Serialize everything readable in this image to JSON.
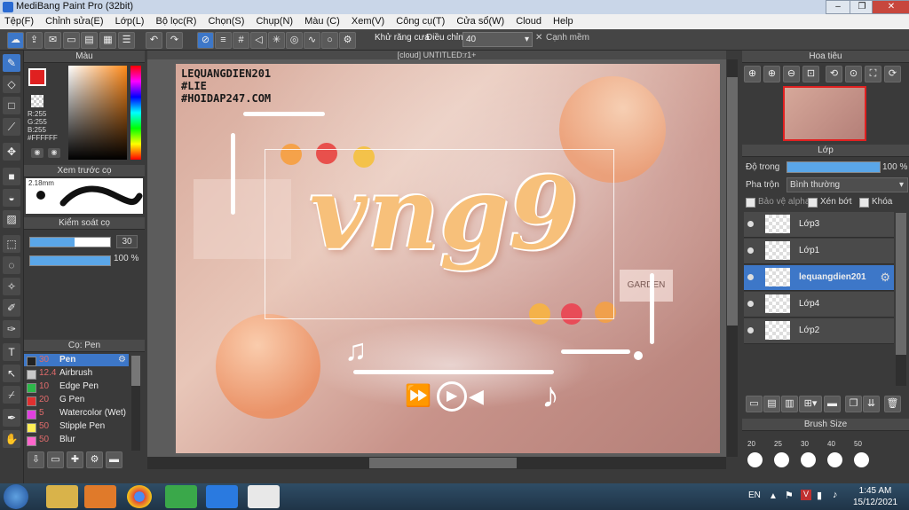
{
  "window": {
    "title": "MediBang Paint Pro (32bit)",
    "minimize": "‒",
    "maximize": "❐",
    "close": "✕"
  },
  "menu": [
    "Tệp(F)",
    "Chỉnh sửa(E)",
    "Lớp(L)",
    "Bộ lọc(R)",
    "Chọn(S)",
    "Chụp(N)",
    "Màu (C)",
    "Xem(V)",
    "Công cụ(T)",
    "Cửa sổ(W)",
    "Cloud",
    "Help"
  ],
  "toolbar": {
    "antialias_label": "Khử răng cưa",
    "adjust_label": "Điều chỉnh",
    "adjust_value": "40",
    "snap_edge_label": "Cạnh mềm"
  },
  "color_panel": {
    "title": "Màu",
    "r": "R:255",
    "g": "G:255",
    "b": "B:255",
    "hex": "#FFFFFF",
    "primary": "#e02020",
    "secondary": "#ffffff"
  },
  "brush_preview": {
    "title": "Xem trước cọ",
    "size": "2.18mm"
  },
  "brush_control": {
    "title": "Kiểm soát cọ",
    "size_value": "30",
    "opacity_value": "100 %"
  },
  "brush_list": {
    "title": "Cọ: Pen",
    "items": [
      {
        "num": "30",
        "name": "Pen",
        "color": "#222222"
      },
      {
        "num": "12.4",
        "name": "Airbrush",
        "color": "#c8c8c8"
      },
      {
        "num": "10",
        "name": "Edge Pen",
        "color": "#2db84a"
      },
      {
        "num": "20",
        "name": "G Pen",
        "color": "#e03030"
      },
      {
        "num": "5",
        "name": "Watercolor (Wet)",
        "color": "#e040e0"
      },
      {
        "num": "50",
        "name": "Stipple Pen",
        "color": "#ffee55"
      },
      {
        "num": "50",
        "name": "Blur",
        "color": "#ff66cc"
      }
    ]
  },
  "canvas": {
    "tab_title": "[cloud] UNTITLED:r1+",
    "watermark_lines": [
      "LEQUANGDIEN201",
      "#LIE",
      "#HOIDAP247.COM"
    ],
    "artwork_text": "vng9",
    "bg_text_garden": "GARDEN"
  },
  "navigator": {
    "title": "Hoa tiêu"
  },
  "layers_panel": {
    "title": "Lớp",
    "opacity_label": "Độ trong",
    "opacity_value": "100 %",
    "blend_label": "Pha trộn",
    "blend_value": "Bình thường",
    "protect_alpha_label": "Bảo vệ alpha",
    "clip_label": "Xén bớt",
    "lock_label": "Khóa",
    "layers": [
      {
        "name": "Lớp3",
        "selected": false
      },
      {
        "name": "Lớp1",
        "selected": false
      },
      {
        "name": "lequangdien201",
        "selected": true
      },
      {
        "name": "Lớp4",
        "selected": false
      },
      {
        "name": "Lớp2",
        "selected": false
      }
    ]
  },
  "brush_size_panel": {
    "title": "Brush Size",
    "sizes": [
      "20",
      "25",
      "30",
      "40",
      "50"
    ]
  },
  "taskbar": {
    "lang": "EN",
    "time": "1:45 AM",
    "date": "15/12/2021"
  }
}
